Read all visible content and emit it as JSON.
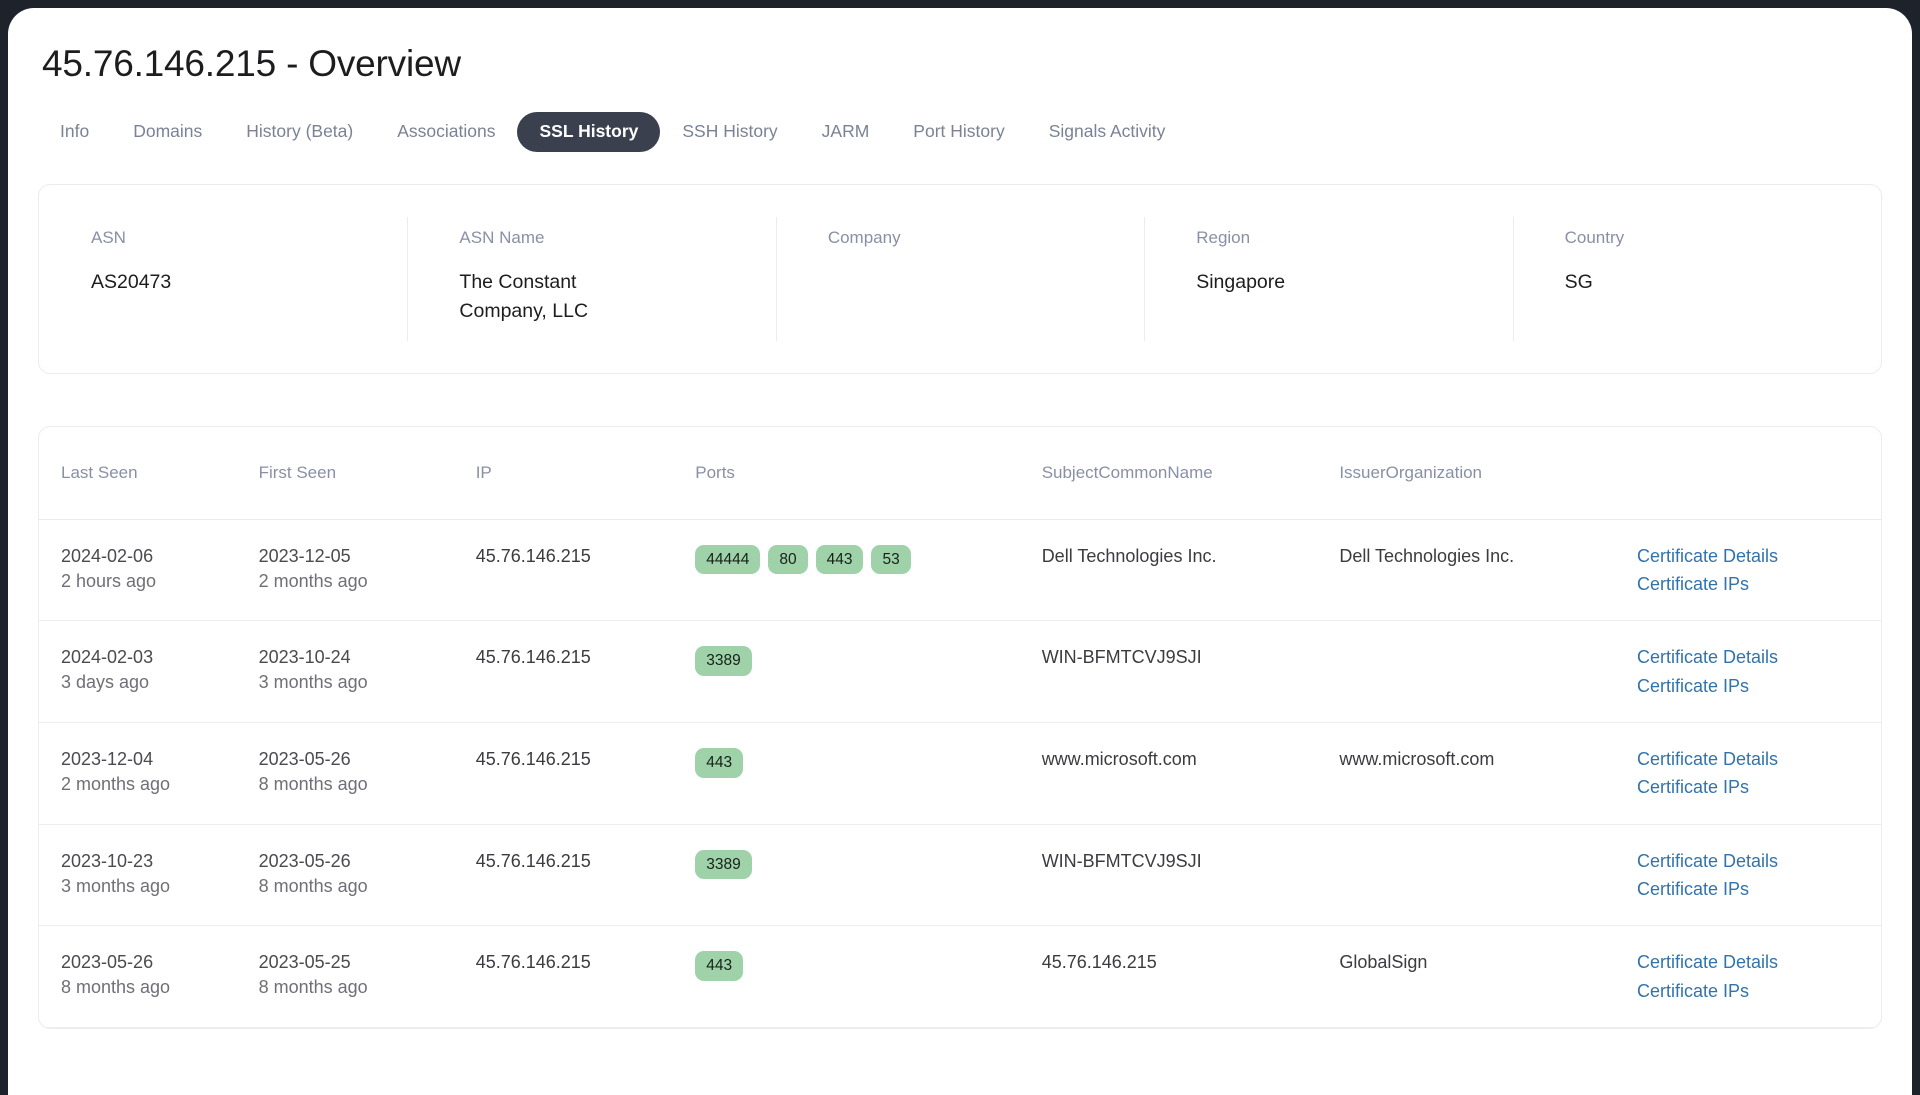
{
  "header": {
    "title": "45.76.146.215 - Overview"
  },
  "tabs": [
    {
      "label": "Info",
      "active": false
    },
    {
      "label": "Domains",
      "active": false
    },
    {
      "label": "History (Beta)",
      "active": false
    },
    {
      "label": "Associations",
      "active": false
    },
    {
      "label": "SSL History",
      "active": true
    },
    {
      "label": "SSH History",
      "active": false
    },
    {
      "label": "JARM",
      "active": false
    },
    {
      "label": "Port History",
      "active": false
    },
    {
      "label": "Signals Activity",
      "active": false
    }
  ],
  "info_card": [
    {
      "label": "ASN",
      "value": "AS20473"
    },
    {
      "label": "ASN Name",
      "value": "The Constant Company, LLC"
    },
    {
      "label": "Company",
      "value": ""
    },
    {
      "label": "Region",
      "value": "Singapore"
    },
    {
      "label": "Country",
      "value": "SG"
    }
  ],
  "table": {
    "columns": [
      "Last Seen",
      "First Seen",
      "IP",
      "Ports",
      "SubjectCommonName",
      "IssuerOrganization",
      ""
    ],
    "link_labels": {
      "details": "Certificate Details",
      "ips": "Certificate IPs"
    },
    "rows": [
      {
        "last_seen_date": "2024-02-06",
        "last_seen_rel": "2 hours ago",
        "first_seen_date": "2023-12-05",
        "first_seen_rel": "2 months ago",
        "ip": "45.76.146.215",
        "ports": [
          "44444",
          "80",
          "443",
          "53"
        ],
        "subject_common_name": "Dell Technologies Inc.",
        "issuer_organization": "Dell Technologies Inc."
      },
      {
        "last_seen_date": "2024-02-03",
        "last_seen_rel": "3 days ago",
        "first_seen_date": "2023-10-24",
        "first_seen_rel": "3 months ago",
        "ip": "45.76.146.215",
        "ports": [
          "3389"
        ],
        "subject_common_name": "WIN-BFMTCVJ9SJI",
        "issuer_organization": ""
      },
      {
        "last_seen_date": "2023-12-04",
        "last_seen_rel": "2 months ago",
        "first_seen_date": "2023-05-26",
        "first_seen_rel": "8 months ago",
        "ip": "45.76.146.215",
        "ports": [
          "443"
        ],
        "subject_common_name": "www.microsoft.com",
        "issuer_organization": "www.microsoft.com"
      },
      {
        "last_seen_date": "2023-10-23",
        "last_seen_rel": "3 months ago",
        "first_seen_date": "2023-05-26",
        "first_seen_rel": "8 months ago",
        "ip": "45.76.146.215",
        "ports": [
          "3389"
        ],
        "subject_common_name": "WIN-BFMTCVJ9SJI",
        "issuer_organization": ""
      },
      {
        "last_seen_date": "2023-05-26",
        "last_seen_rel": "8 months ago",
        "first_seen_date": "2023-05-25",
        "first_seen_rel": "8 months ago",
        "ip": "45.76.146.215",
        "ports": [
          "443"
        ],
        "subject_common_name": "45.76.146.215",
        "issuer_organization": "GlobalSign"
      }
    ]
  },
  "colors": {
    "active_tab_bg": "#3a404d",
    "port_badge_bg": "#9fd2a9",
    "link": "#3273ab",
    "label_text": "#8990a5"
  }
}
